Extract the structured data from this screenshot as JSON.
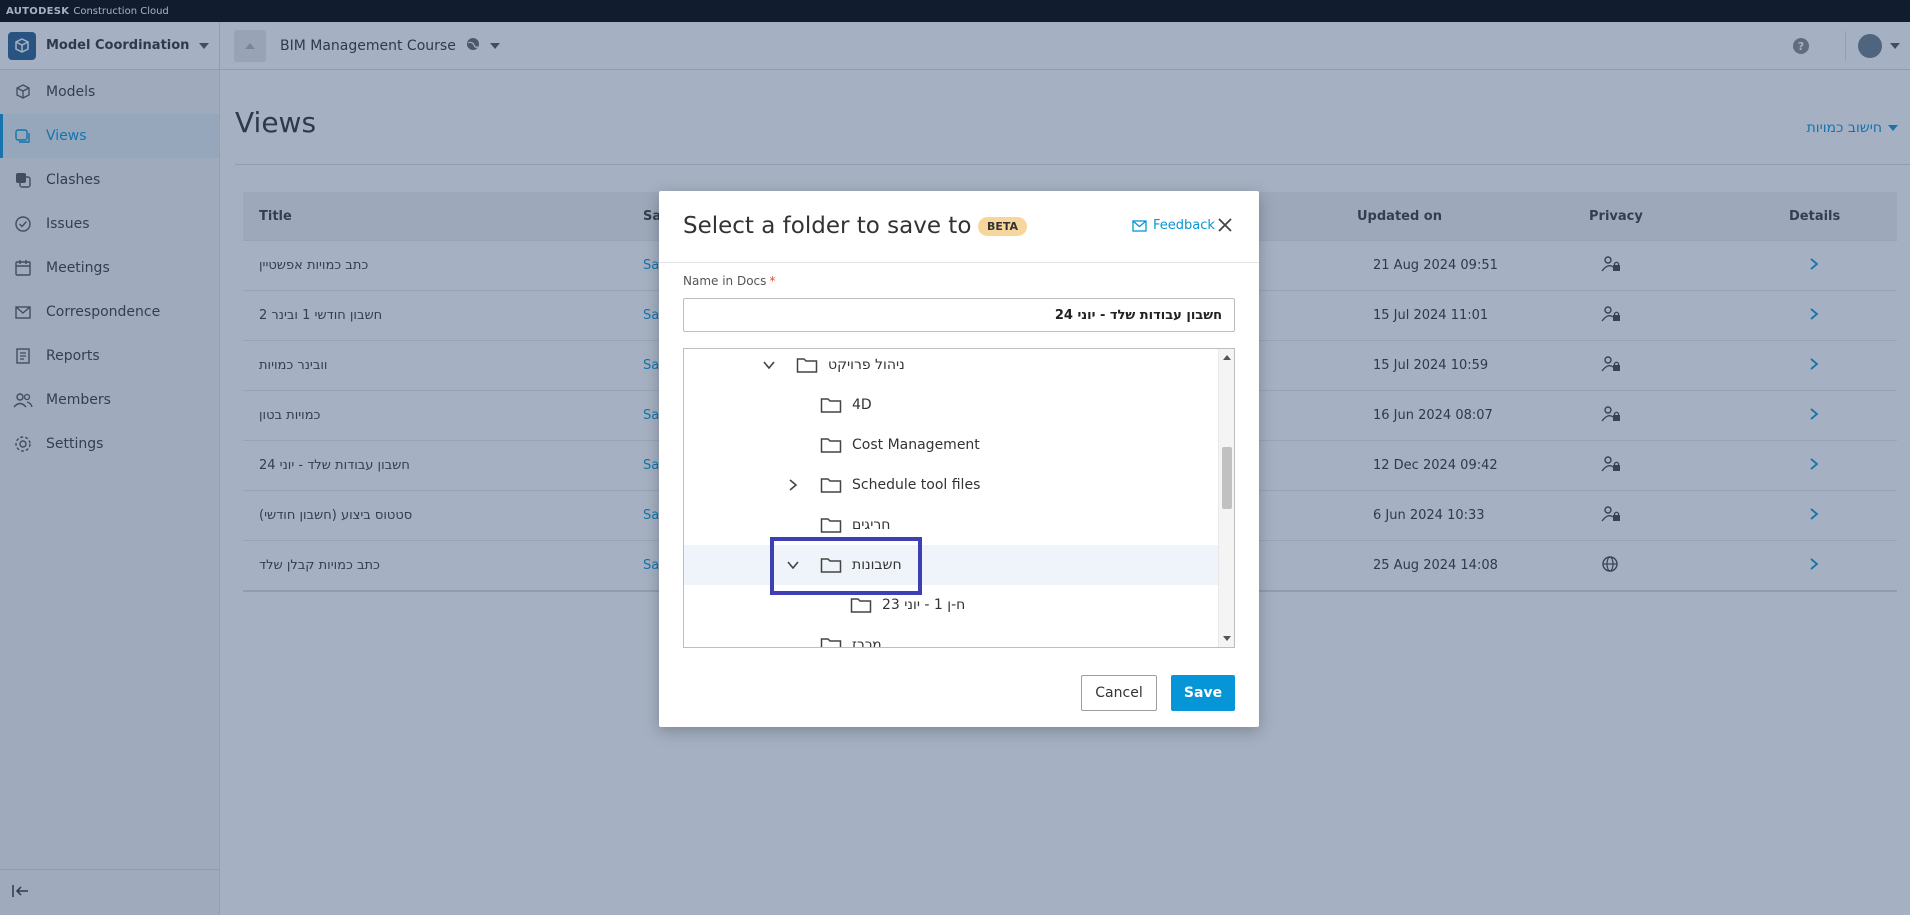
{
  "brand": {
    "name": "AUTODESK",
    "product": "Construction Cloud"
  },
  "header": {
    "app_name": "Model Coordination",
    "project_name": "BIM Management Course"
  },
  "sidebar": {
    "items": [
      {
        "label": "Models",
        "icon": "cube-icon"
      },
      {
        "label": "Views",
        "icon": "views-icon",
        "active": true
      },
      {
        "label": "Clashes",
        "icon": "clashes-icon"
      },
      {
        "label": "Issues",
        "icon": "issues-icon"
      },
      {
        "label": "Meetings",
        "icon": "calendar-icon"
      },
      {
        "label": "Correspondence",
        "icon": "envelope-icon"
      },
      {
        "label": "Reports",
        "icon": "reports-icon"
      },
      {
        "label": "Members",
        "icon": "members-icon"
      },
      {
        "label": "Settings",
        "icon": "gear-icon"
      }
    ]
  },
  "main": {
    "title": "Views",
    "view_selector": "חישוב כמויות",
    "table": {
      "headers": {
        "title": "Title",
        "saved": "Sa",
        "updated": "Updated on",
        "privacy": "Privacy",
        "details": "Details"
      },
      "rows": [
        {
          "title": "כתב כמויות אפשטיין",
          "saved": "Sa",
          "updated": "21 Aug 2024 09:51",
          "privacy": "private"
        },
        {
          "title": "חשבון חודשי 1 ובינר 2",
          "saved": "Sa",
          "updated": "15 Jul 2024 11:01",
          "privacy": "private"
        },
        {
          "title": "וובינר כמויות",
          "saved": "Sa",
          "updated": "15 Jul 2024 10:59",
          "privacy": "private"
        },
        {
          "title": "כמויות בטון",
          "saved": "Sa",
          "updated": "16 Jun 2024 08:07",
          "privacy": "private"
        },
        {
          "title": "חשבון עבודות שלד - יוני 24",
          "saved": "Sa",
          "updated": "12 Dec 2024 09:42",
          "privacy": "private"
        },
        {
          "title": "סטטוס ביצוע (חשבון חודשי)",
          "saved": "Sa",
          "updated": "6 Jun 2024 10:33",
          "privacy": "private"
        },
        {
          "title": "כתב כמויות קבלן שלד",
          "saved": "Sa",
          "updated": "25 Aug 2024 14:08",
          "privacy": "public"
        }
      ]
    }
  },
  "modal": {
    "title": "Select a folder to save to",
    "badge": "BETA",
    "feedback": "Feedback",
    "name_label": "Name in Docs",
    "required_mark": "*",
    "name_value": "חשבון עבודות שלד - יוני 24",
    "tree": [
      {
        "label": "ניהול פרויקט",
        "expand": "down",
        "level": 0
      },
      {
        "label": "4D",
        "expand": "none",
        "level": 1
      },
      {
        "label": "Cost Management",
        "expand": "none",
        "level": 1
      },
      {
        "label": "Schedule tool files",
        "expand": "right",
        "level": 1
      },
      {
        "label": "חריגים",
        "expand": "none",
        "level": 1
      },
      {
        "label": "חשבונות",
        "expand": "down",
        "level": 1,
        "selected": true
      },
      {
        "label": "ח-ן 1 - יוני 23",
        "expand": "none",
        "level": 2
      },
      {
        "label": "מכרז",
        "expand": "none",
        "level": 1
      }
    ],
    "cancel_label": "Cancel",
    "save_label": "Save"
  }
}
